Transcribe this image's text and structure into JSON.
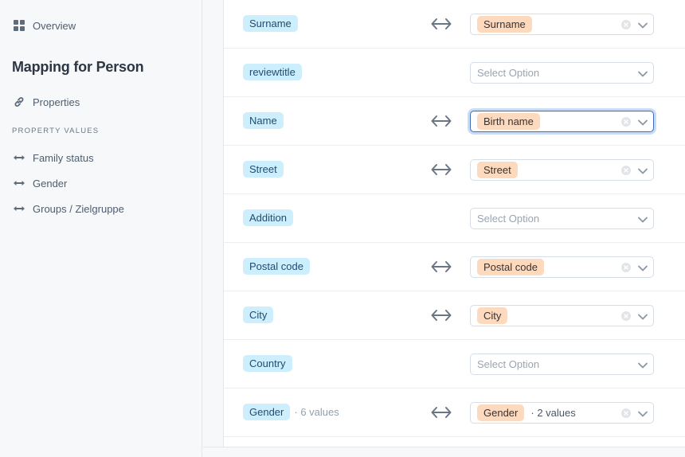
{
  "sidebar": {
    "overview_label": "Overview",
    "title": "Mapping for Person",
    "properties_label": "Properties",
    "section_label": "PROPERTY VALUES",
    "value_items": [
      {
        "label": "Family status"
      },
      {
        "label": "Gender"
      },
      {
        "label": "Groups / Zielgruppe"
      }
    ]
  },
  "select_placeholder": "Select Option",
  "rows": [
    {
      "source": "Surname",
      "source_meta": "",
      "mapped": true,
      "target": "Surname",
      "target_meta": ""
    },
    {
      "source": "reviewtitle",
      "source_meta": "",
      "mapped": false,
      "target": "",
      "target_meta": ""
    },
    {
      "source": "Name",
      "source_meta": "",
      "mapped": true,
      "target": "Birth name",
      "target_meta": "",
      "focused": true
    },
    {
      "source": "Street",
      "source_meta": "",
      "mapped": true,
      "target": "Street",
      "target_meta": ""
    },
    {
      "source": "Addition",
      "source_meta": "",
      "mapped": false,
      "target": "",
      "target_meta": ""
    },
    {
      "source": "Postal code",
      "source_meta": "",
      "mapped": true,
      "target": "Postal code",
      "target_meta": ""
    },
    {
      "source": "City",
      "source_meta": "",
      "mapped": true,
      "target": "City",
      "target_meta": ""
    },
    {
      "source": "Country",
      "source_meta": "",
      "mapped": false,
      "target": "",
      "target_meta": ""
    },
    {
      "source": "Gender",
      "source_meta": "· 6 values",
      "mapped": true,
      "target": "Gender",
      "target_meta": "· 2 values"
    }
  ]
}
